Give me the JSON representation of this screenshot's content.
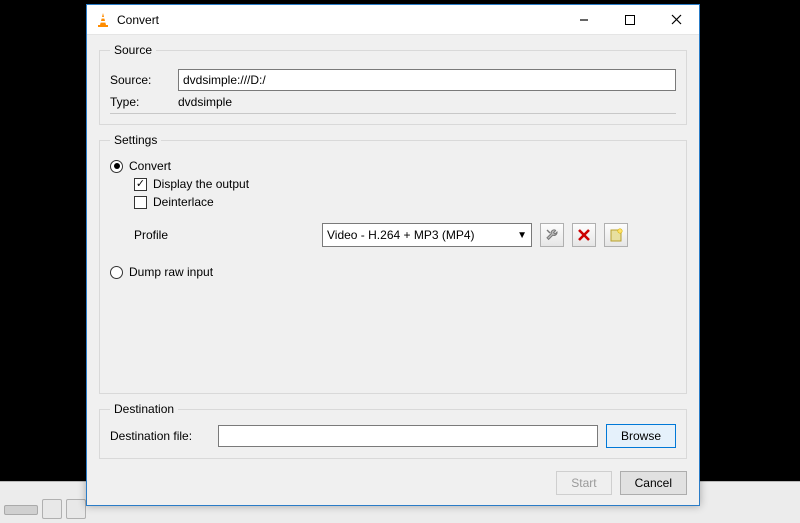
{
  "window": {
    "title": "Convert"
  },
  "source": {
    "legend": "Source",
    "source_label": "Source:",
    "source_value": "dvdsimple:///D:/",
    "type_label": "Type:",
    "type_value": "dvdsimple"
  },
  "settings": {
    "legend": "Settings",
    "convert_label": "Convert",
    "display_output_label": "Display the output",
    "display_output_checked": true,
    "deinterlace_label": "Deinterlace",
    "deinterlace_checked": false,
    "profile_label": "Profile",
    "profile_value": "Video - H.264 + MP3 (MP4)",
    "dump_label": "Dump raw input",
    "tool_edit": "wrench-icon",
    "tool_delete": "delete-icon",
    "tool_new": "new-profile-icon"
  },
  "destination": {
    "legend": "Destination",
    "dest_label": "Destination file:",
    "dest_value": "",
    "browse_label": "Browse"
  },
  "actions": {
    "start_label": "Start",
    "cancel_label": "Cancel"
  }
}
